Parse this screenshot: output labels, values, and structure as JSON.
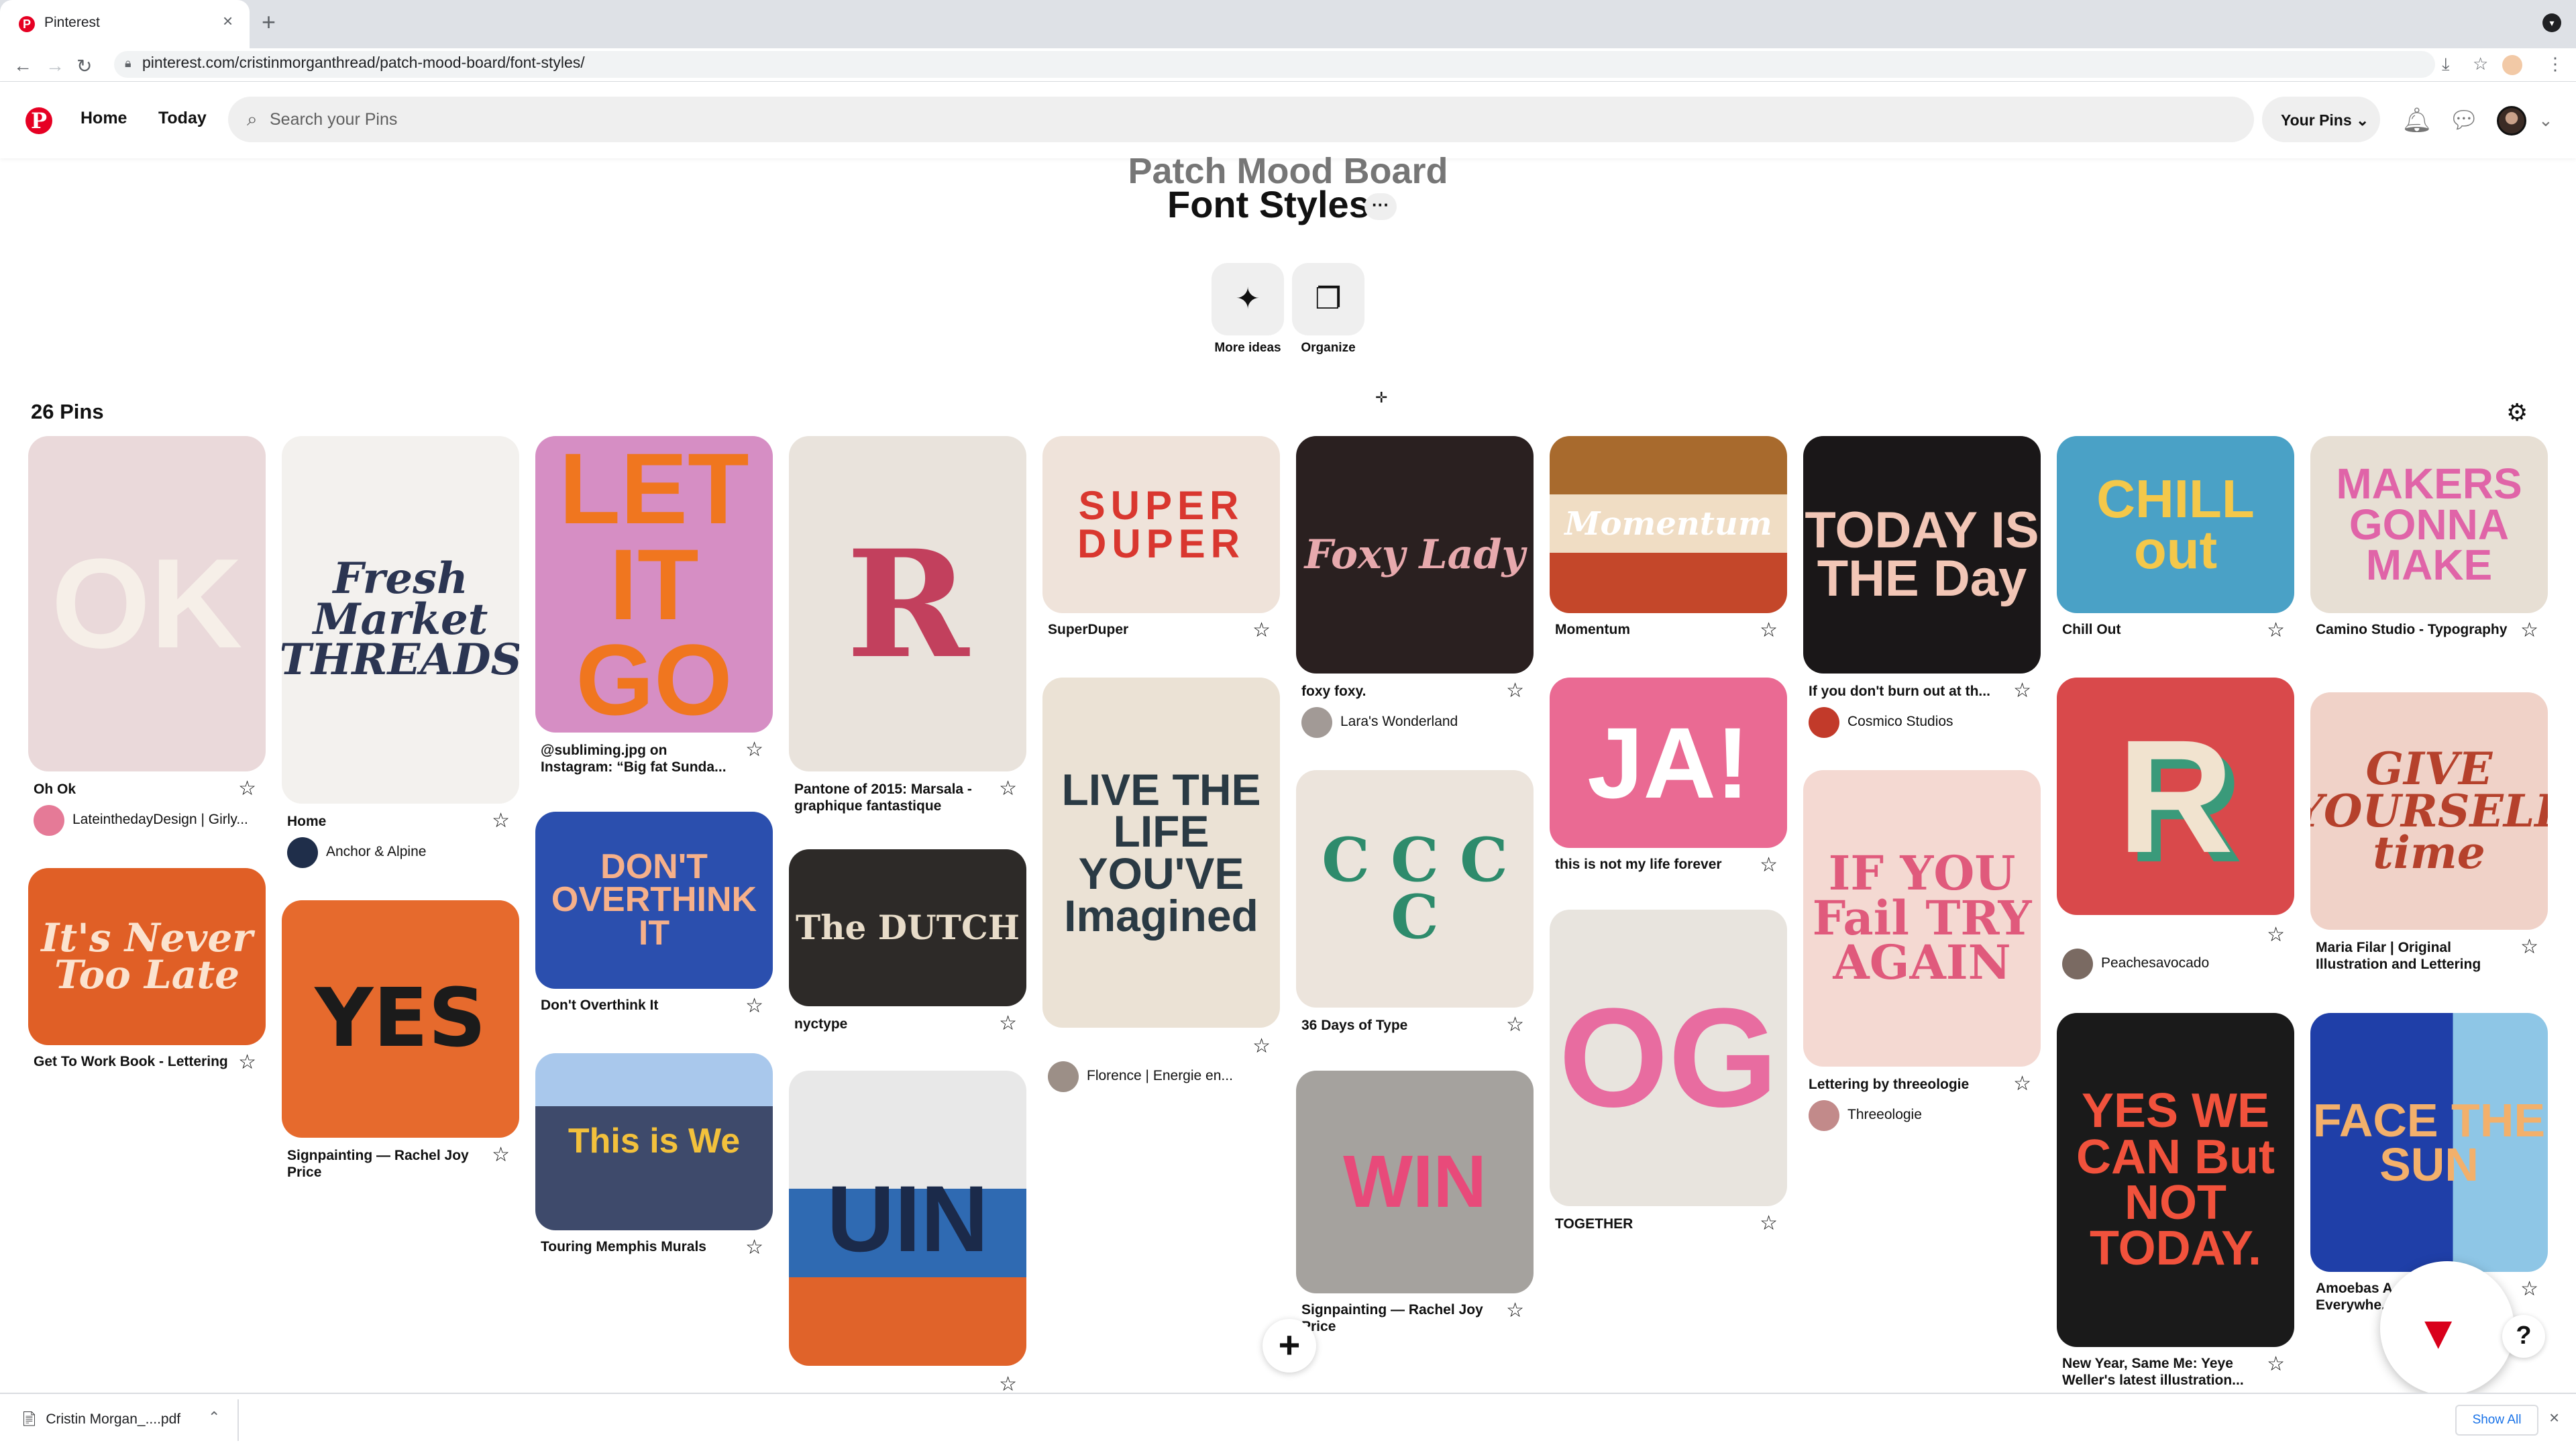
{
  "browser": {
    "tab_title": "Pinterest",
    "new_tab": "+",
    "url": "pinterest.com/cristinmorganthread/patch-mood-board/font-styles/"
  },
  "header": {
    "logo": "P",
    "nav": [
      "Home",
      "Today"
    ],
    "search_placeholder": "Search your Pins",
    "your_pins": "Your Pins"
  },
  "board": {
    "parent": "Patch Mood Board",
    "title": "Font Styles",
    "more": "···",
    "actions": [
      {
        "label": "More ideas",
        "icon": "sparkle-icon"
      },
      {
        "label": "Organize",
        "icon": "organize-icon"
      }
    ],
    "pin_count": "26 Pins"
  },
  "pins": [
    {
      "title": "Oh Ok",
      "author": "LateinthedayDesign | Girly...",
      "img_text": "OK"
    },
    {
      "title": "Get To Work Book - Lettering",
      "author": "",
      "img_text": "It's Never Too Late"
    },
    {
      "title": "Home",
      "author": "Anchor & Alpine",
      "img_text": "Fresh Market THREADS"
    },
    {
      "title": "Signpainting — Rachel Joy Price",
      "author": "",
      "img_text": "YES"
    },
    {
      "title": "@subliming.jpg on Instagram: “Big fat Sunda...",
      "author": "",
      "img_text": "LET IT GO"
    },
    {
      "title": "Don't Overthink It",
      "author": "",
      "img_text": "DON'T OVERTHINK IT"
    },
    {
      "title": "Touring Memphis Murals",
      "author": "",
      "img_text": "This is We"
    },
    {
      "title": "Pantone of 2015: Marsala - graphique fantastique",
      "author": "",
      "img_text": "R"
    },
    {
      "title": "nyctype",
      "author": "",
      "img_text": "The DUTCH"
    },
    {
      "title": "",
      "author": "",
      "img_text": "UIN"
    },
    {
      "title": "SuperDuper",
      "author": "",
      "img_text": "SUPER DUPER"
    },
    {
      "title": "",
      "author": "Florence | Energie en...",
      "img_text": "LIVE THE LIFE YOU'VE Imagined"
    },
    {
      "title": "foxy foxy.",
      "author": "Lara's Wonderland",
      "img_text": "Foxy Lady"
    },
    {
      "title": "36 Days of Type",
      "author": "",
      "img_text": "C C C C"
    },
    {
      "title": "Signpainting — Rachel Joy Price",
      "author": "",
      "img_text": "WIN"
    },
    {
      "title": "Momentum",
      "author": "",
      "img_text": "Momentum"
    },
    {
      "title": "this is not my life forever",
      "author": "",
      "img_text": "JA!"
    },
    {
      "title": "TOGETHER",
      "author": "",
      "img_text": "OG"
    },
    {
      "title": "If you don't burn out at th...",
      "author": "Cosmico Studios",
      "img_text": "TODAY IS THE Day"
    },
    {
      "title": "Lettering by threeologie",
      "author": "Threeologie",
      "img_text": "IF YOU Fail TRY AGAIN"
    },
    {
      "title": "Chill Out",
      "author": "",
      "img_text": "CHILL out"
    },
    {
      "title": "",
      "author": "Peachesavocado",
      "img_text": "R"
    },
    {
      "title": "New Year, Same Me: Yeye Weller's latest illustration...",
      "author": "",
      "img_text": "YES WE CAN But NOT TODAY."
    },
    {
      "title": "Camino Studio - Typography",
      "author": "",
      "img_text": "MAKERS GONNA MAKE"
    },
    {
      "title": "Maria Filar | Original Illustration and Lettering",
      "author": "",
      "img_text": "GIVE YOURSELF time"
    },
    {
      "title": "Amoebas A... Everywhe...",
      "author": "",
      "img_text": "FACE THE SUN"
    }
  ],
  "floating": {
    "add": "+",
    "help": "?",
    "widget_logo": "▼"
  },
  "downloads": {
    "file": "Cristin Morgan_....pdf",
    "show_all": "Show All"
  }
}
